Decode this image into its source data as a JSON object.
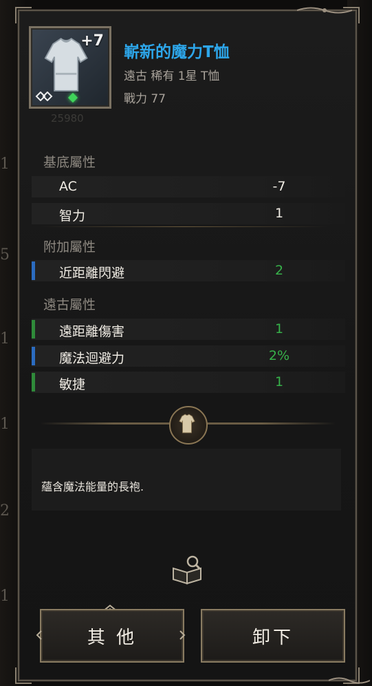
{
  "item": {
    "enhance": "+7",
    "code": "25980",
    "name": "嶄新的魔力T恤",
    "subtitle": "遠古 稀有 1星 T恤",
    "power": "戰力 77"
  },
  "sections": {
    "base": {
      "title": "基底屬性",
      "stats": [
        {
          "label": "AC",
          "value": "-7"
        },
        {
          "label": "智力",
          "value": "1"
        }
      ]
    },
    "extra": {
      "title": "附加屬性",
      "stats": [
        {
          "label": "近距離閃避",
          "value": "2",
          "bar": "blue"
        }
      ]
    },
    "ancient": {
      "title": "遠古屬性",
      "stats": [
        {
          "label": "遠距離傷害",
          "value": "1",
          "bar": "green"
        },
        {
          "label": "魔法迴避力",
          "value": "2%",
          "bar": "blue"
        },
        {
          "label": "敏捷",
          "value": "1",
          "bar": "green"
        }
      ]
    }
  },
  "description": "蘊含魔法能量的長袍.",
  "buttons": {
    "other": "其 他",
    "unequip": "卸下"
  },
  "background_numbers": [
    "1",
    "5",
    "1",
    "1",
    "2",
    "1"
  ],
  "colors": {
    "name": "#2da6ea",
    "green_value": "#37b24a",
    "blue_bar": "#2b6cc0",
    "green_bar": "#2f8a3a"
  },
  "icons": [
    "tshirt-icon",
    "lock-icon",
    "gem-icon",
    "shirt-emblem-icon",
    "book-search-icon",
    "chevron-up-icon"
  ]
}
